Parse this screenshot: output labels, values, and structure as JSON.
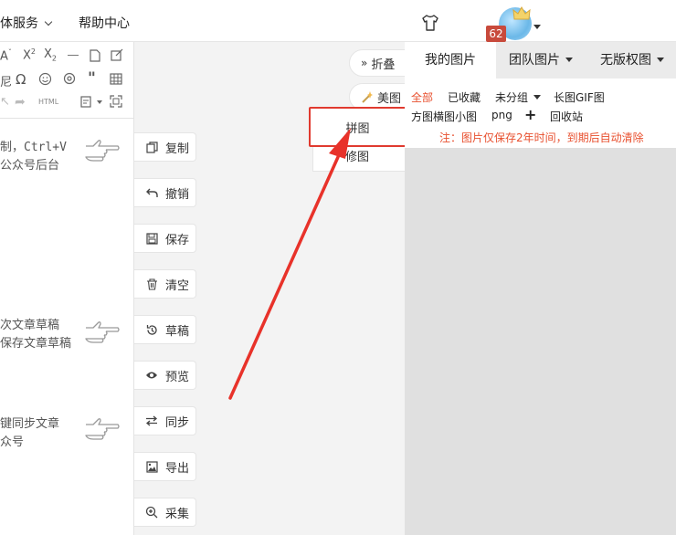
{
  "topnav": {
    "item1": "体服务",
    "item2": "帮助中心",
    "badge": "62"
  },
  "toolbar": {
    "html_label": "HTML"
  },
  "hints": [
    [
      "制，Ctrl+V",
      "公众号后台"
    ],
    [
      "次文章草稿",
      "保存文章草稿"
    ],
    [
      "键同步文章",
      "众号"
    ]
  ],
  "side_buttons": [
    {
      "label": "复制",
      "icon": "copy-icon"
    },
    {
      "label": "撤销",
      "icon": "undo-icon"
    },
    {
      "label": "保存",
      "icon": "save-icon"
    },
    {
      "label": "清空",
      "icon": "trash-icon"
    },
    {
      "label": "草稿",
      "icon": "history-icon"
    },
    {
      "label": "预览",
      "icon": "eye-icon"
    },
    {
      "label": "同步",
      "icon": "sync-icon"
    },
    {
      "label": "导出",
      "icon": "image-export-icon"
    },
    {
      "label": "采集",
      "icon": "search-plus-icon"
    }
  ],
  "image_tools": {
    "fold": "折叠",
    "meitu": "美图",
    "pintu": "拼图",
    "xiutu": "修图"
  },
  "right_panel": {
    "tabs": [
      "我的图片",
      "团队图片",
      "无版权图"
    ],
    "filters_row1": [
      "全部",
      "已收藏",
      "未分组",
      "长图GIF图"
    ],
    "filters_row2": [
      "方图横图小图",
      "png",
      "+",
      "回收站"
    ],
    "notice": "注：图片仅保存2年时间，到期后自动清除"
  },
  "colors": {
    "accent_orange": "#e8502f",
    "highlight_red": "#e03a2f",
    "badge_red": "#c84a3c"
  }
}
